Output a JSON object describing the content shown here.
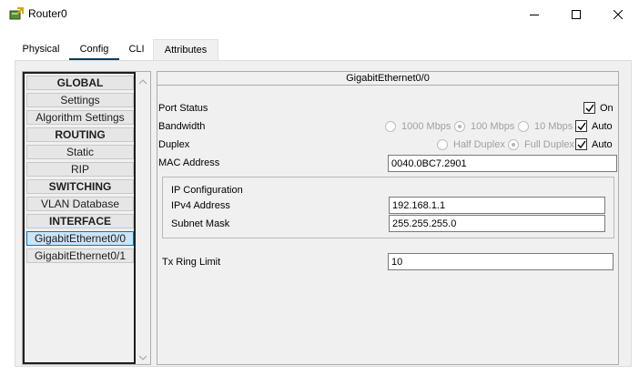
{
  "window": {
    "title": "Router0",
    "icon": "router-icon",
    "controls": [
      "minimize-icon",
      "maximize-icon",
      "close-icon"
    ]
  },
  "tabs": [
    {
      "label": "Physical"
    },
    {
      "label": "Config",
      "active": true
    },
    {
      "label": "CLI"
    },
    {
      "label": "Attributes"
    }
  ],
  "nav": {
    "items": [
      {
        "label": "GLOBAL",
        "type": "header"
      },
      {
        "label": "Settings",
        "type": "item"
      },
      {
        "label": "Algorithm Settings",
        "type": "item"
      },
      {
        "label": "ROUTING",
        "type": "header"
      },
      {
        "label": "Static",
        "type": "item"
      },
      {
        "label": "RIP",
        "type": "item"
      },
      {
        "label": "SWITCHING",
        "type": "header"
      },
      {
        "label": "VLAN Database",
        "type": "item"
      },
      {
        "label": "INTERFACE",
        "type": "header"
      },
      {
        "label": "GigabitEthernet0/0",
        "type": "item",
        "selected": true
      },
      {
        "label": "GigabitEthernet0/1",
        "type": "item"
      }
    ]
  },
  "interface": {
    "title": "GigabitEthernet0/0",
    "port_status": {
      "label": "Port Status",
      "on_label": "On",
      "on": true
    },
    "bandwidth": {
      "label": "Bandwidth",
      "options": [
        "1000 Mbps",
        "100 Mbps",
        "10 Mbps"
      ],
      "selected": "100 Mbps",
      "auto_label": "Auto",
      "auto": true
    },
    "duplex": {
      "label": "Duplex",
      "options": [
        "Half Duplex",
        "Full Duplex"
      ],
      "selected": "Full Duplex",
      "auto_label": "Auto",
      "auto": true
    },
    "mac": {
      "label": "MAC Address",
      "value": "0040.0BC7.2901"
    },
    "ip_config": {
      "label": "IP Configuration",
      "ipv4_label": "IPv4 Address",
      "ipv4_value": "192.168.1.1",
      "mask_label": "Subnet Mask",
      "mask_value": "255.255.255.0"
    },
    "tx_ring": {
      "label": "Tx Ring Limit",
      "value": "10"
    }
  },
  "colors": {
    "selected_tab_underline": "#0e3d59",
    "selected_nav_bg": "#cce4f7",
    "selected_nav_border": "#0078d7"
  }
}
